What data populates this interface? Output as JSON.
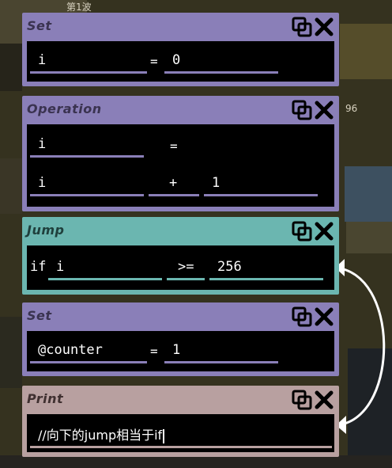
{
  "background": {
    "top_text": "第1波",
    "side_text": "96"
  },
  "blocks": {
    "set1": {
      "title": "Set",
      "var": "i",
      "op": "=",
      "value": "0"
    },
    "operation": {
      "title": "Operation",
      "result": "i",
      "op": "=",
      "a": "i",
      "operator": "+",
      "b": "1"
    },
    "jump": {
      "title": "Jump",
      "if_label": "if",
      "a": "i",
      "cmp": ">=",
      "b": "256"
    },
    "set2": {
      "title": "Set",
      "var": "@counter",
      "op": "=",
      "value": "1"
    },
    "print": {
      "title": "Print",
      "text": "//向下的jump相当于if"
    }
  },
  "colors": {
    "set": "#8a7fb8",
    "operation": "#8a7fb8",
    "jump": "#6bb6b0",
    "print": "#b8a0a0"
  },
  "icons": {
    "copy": "copy-icon",
    "close": "close-icon"
  }
}
